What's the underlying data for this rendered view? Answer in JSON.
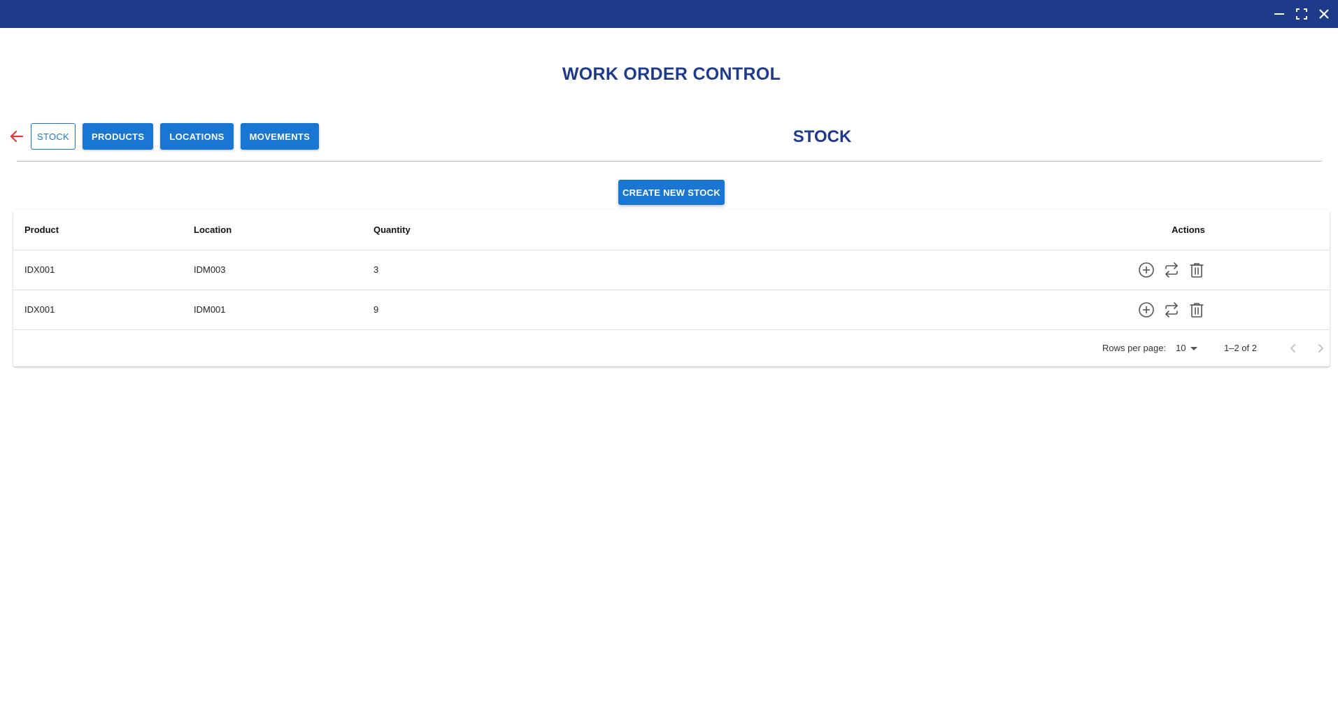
{
  "app": {
    "title": "WORK ORDER CONTROL"
  },
  "nav": {
    "tabs": [
      {
        "label": "STOCK",
        "active": true
      },
      {
        "label": "PRODUCTS",
        "active": false
      },
      {
        "label": "LOCATIONS",
        "active": false
      },
      {
        "label": "MOVEMENTS",
        "active": false
      }
    ]
  },
  "section": {
    "title": "STOCK",
    "create_label": "CREATE NEW STOCK"
  },
  "table": {
    "columns": [
      "Product",
      "Location",
      "Quantity",
      "Actions"
    ],
    "rows": [
      {
        "product": "IDX001",
        "location": "IDM003",
        "quantity": "3"
      },
      {
        "product": "IDX001",
        "location": "IDM001",
        "quantity": "9"
      }
    ],
    "row_actions": [
      "add-circle-icon",
      "swap-icon",
      "trash-icon"
    ]
  },
  "pagination": {
    "rows_per_page_label": "Rows per page:",
    "rows_per_page": "10",
    "range": "1–2 of 2"
  },
  "colors": {
    "titlebar": "#1e3a8a",
    "heading": "#1e3a8a",
    "primary": "#1976d2",
    "back_arrow": "#e53935"
  },
  "icons": {
    "window": [
      "minimize-icon",
      "maximize-icon",
      "close-icon"
    ],
    "back": "arrow-left-icon"
  }
}
